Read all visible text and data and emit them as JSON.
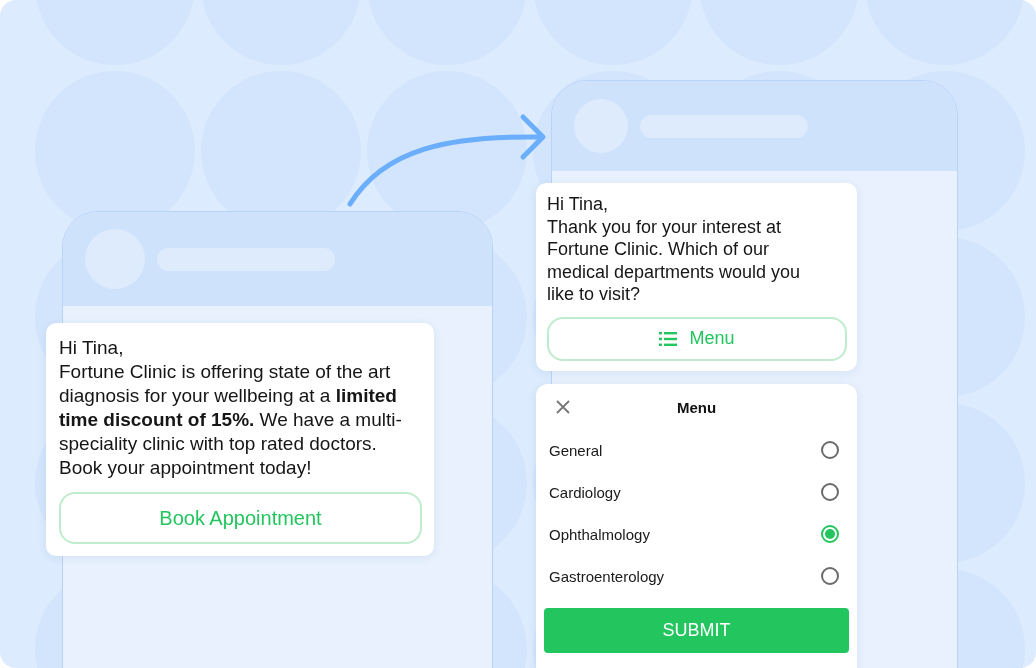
{
  "chats": [
    {
      "message": "Hi Tina,\nFortune Clinic is offering state of the art diagnosis for your wellbeing at a **limited time discount of 15%.** We have a multi-speciality clinic with top rated doctors. Book your appointment today!",
      "button": {
        "label": "Book Appointment",
        "kind": "plain"
      }
    },
    {
      "message": "Hi Tina,\nThank you for your interest at Fortune Clinic. Which of our medical departments would you like to visit?",
      "button": {
        "label": "Menu",
        "kind": "menu"
      }
    }
  ],
  "menu_sheet": {
    "title": "Menu",
    "options": [
      {
        "label": "General",
        "selected": false
      },
      {
        "label": "Cardiology",
        "selected": false
      },
      {
        "label": "Ophthalmology",
        "selected": true
      },
      {
        "label": "Gastroenterology",
        "selected": false
      }
    ],
    "submit": "SUBMIT"
  }
}
